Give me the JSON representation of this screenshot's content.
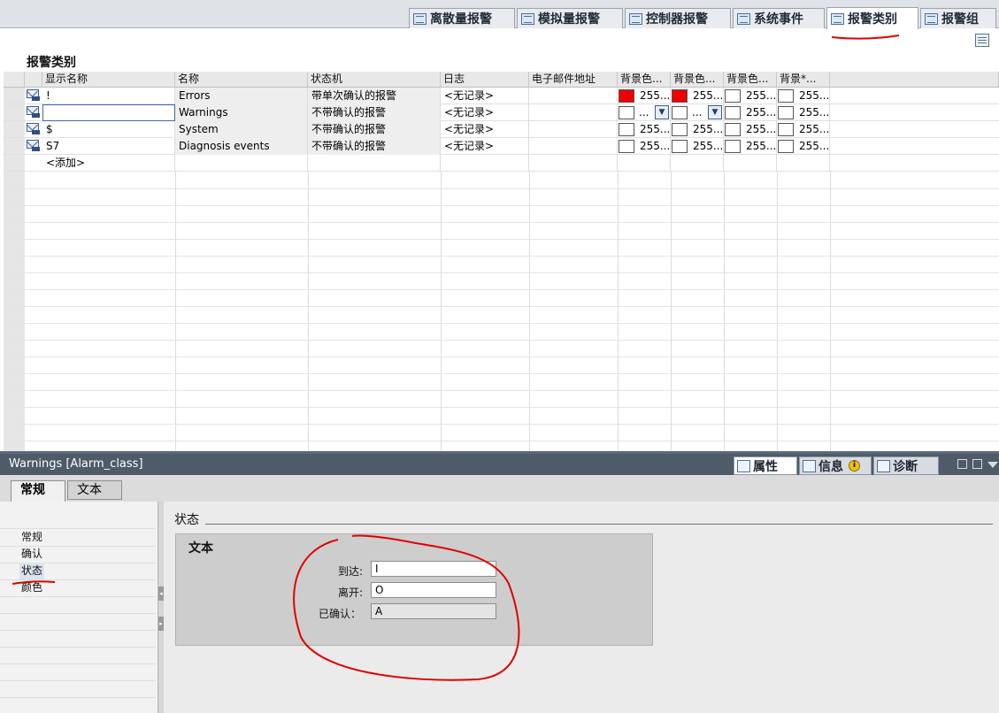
{
  "top_tabs": [
    {
      "label": "离散量报警"
    },
    {
      "label": "模拟量报警"
    },
    {
      "label": "控制器报警"
    },
    {
      "label": "系统事件"
    },
    {
      "label": "报警类别"
    },
    {
      "label": "报警组"
    }
  ],
  "grid": {
    "title": "报警类别",
    "columns": [
      "显示名称",
      "名称",
      "状态机",
      "日志",
      "电子邮件地址",
      "背景色...",
      "背景色...",
      "背景色...",
      "背景*..."
    ],
    "rows": [
      {
        "display": "!",
        "name": "Errors",
        "state_machine": "带单次确认的报警",
        "log": "<无记录>",
        "c1": "255...",
        "c2": "255...",
        "c3": "255...",
        "c4": "255..."
      },
      {
        "display": "",
        "name": "Warnings",
        "state_machine": "不带确认的报警",
        "log": "<无记录>",
        "c1": "...",
        "c2": "...",
        "c3": "255...",
        "c4": "255..."
      },
      {
        "display": "$",
        "name": "System",
        "state_machine": "不带确认的报警",
        "log": "<无记录>",
        "c1": "255...",
        "c2": "255...",
        "c3": "255...",
        "c4": "255..."
      },
      {
        "display": "S7",
        "name": "Diagnosis events",
        "state_machine": "不带确认的报警",
        "log": "<无记录>",
        "c1": "255...",
        "c2": "255...",
        "c3": "255...",
        "c4": "255..."
      }
    ],
    "add_label": "<添加>"
  },
  "inspector": {
    "title": "Warnings [Alarm_class]",
    "tabs": {
      "properties": "属性",
      "info": "信息",
      "diagnostics": "诊断"
    },
    "subtabs": {
      "general": "常规",
      "text": "文本"
    },
    "nav": [
      "常规",
      "确认",
      "状态",
      "颜色"
    ],
    "section": "状态",
    "panel_title": "文本",
    "fields": {
      "arrive_label": "到达:",
      "arrive_value": "I",
      "leave_label": "离开:",
      "leave_value": "O",
      "ack_label": "已确认：",
      "ack_value": "A"
    }
  },
  "colors": {
    "red_swatch": "#ee0000",
    "annotation": "#e00000",
    "inspector_header": "#4f5b69"
  },
  "icons": [
    "alarm-class-icon",
    "info-icon",
    "list-view-icon",
    "restore-icon",
    "minimize-icon",
    "collapse-icon"
  ]
}
